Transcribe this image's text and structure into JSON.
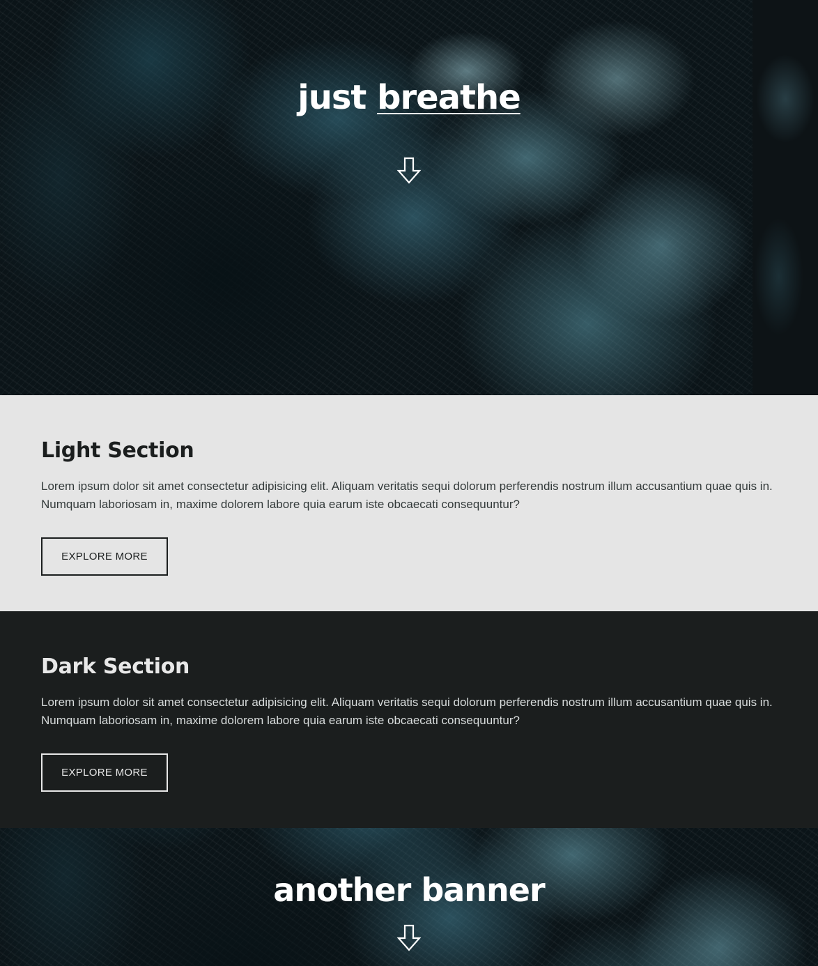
{
  "hero": {
    "title_part1": "just ",
    "title_part2": "breathe",
    "arrow_icon": "down-arrow-icon"
  },
  "light_section": {
    "heading": "Light Section",
    "body": "Lorem ipsum dolor sit amet consectetur adipisicing elit. Aliquam veritatis sequi dolorum perferendis nostrum illum accusantium quae quis in. Numquam laboriosam in, maxime dolorem labore quia earum iste obcaecati consequuntur?",
    "button_label": "EXPLORE MORE"
  },
  "dark_section": {
    "heading": "Dark Section",
    "body": "Lorem ipsum dolor sit amet consectetur adipisicing elit. Aliquam veritatis sequi dolorum perferendis nostrum illum accusantium quae quis in. Numquam laboriosam in, maxime dolorem labore quia earum iste obcaecati consequuntur?",
    "button_label": "EXPLORE MORE"
  },
  "banner2": {
    "title": "another banner",
    "arrow_icon": "down-arrow-icon"
  },
  "colors": {
    "light_bg": "#e5e5e5",
    "dark_bg": "#1b1e1e",
    "text_light": "#ffffff"
  }
}
